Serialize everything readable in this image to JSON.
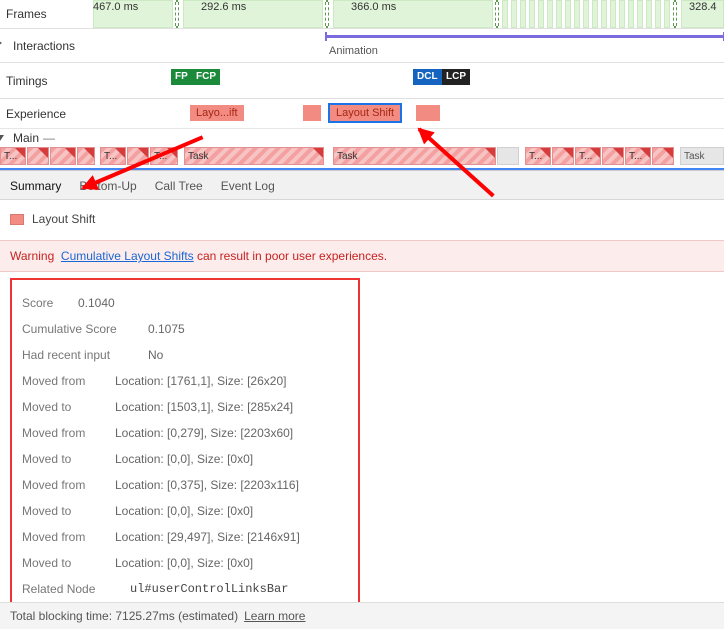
{
  "rows": {
    "frames": "Frames",
    "interactions": "Interactions",
    "timings": "Timings",
    "experience": "Experience",
    "main": "Main"
  },
  "frames": {
    "t0": "467.0 ms",
    "t1": "292.6 ms",
    "t2": "366.0 ms",
    "t3": "328.4"
  },
  "animation_label": "Animation",
  "timing_badges": {
    "fp": "FP",
    "fcp": "FCP",
    "dcl": "DCL",
    "lcp": "LCP"
  },
  "experience": {
    "chip1": "Layo...ift",
    "chip2": "Layout Shift"
  },
  "main_dash": "—",
  "tasks": {
    "short": "T...",
    "task": "Task"
  },
  "tabs": {
    "summary": "Summary",
    "bottomup": "Bottom-Up",
    "calltree": "Call Tree",
    "eventlog": "Event Log"
  },
  "legend": "Layout Shift",
  "warning": {
    "prefix": "Warning",
    "link": "Cumulative Layout Shifts",
    "suffix": " can result in poor user experiences."
  },
  "details": {
    "score_k": "Score",
    "score_v": "0.1040",
    "cumscore_k": "Cumulative Score",
    "cumscore_v": "0.1075",
    "hadinput_k": "Had recent input",
    "hadinput_v": "No",
    "mf": "Moved from",
    "mt": "Moved to",
    "loc1": "Location: [1761,1], Size: [26x20]",
    "loc2": "Location: [1503,1], Size: [285x24]",
    "loc3": "Location: [0,279], Size: [2203x60]",
    "loc4": "Location: [0,0], Size: [0x0]",
    "loc5": "Location: [0,375], Size: [2203x116]",
    "loc6": "Location: [0,0], Size: [0x0]",
    "loc7": "Location: [29,497], Size: [2146x91]",
    "loc8": "Location: [0,0], Size: [0x0]",
    "related_k": "Related Node",
    "related_v": "ul#userControlLinksBar"
  },
  "footer": {
    "text": "Total blocking time: 7125.27ms (estimated)",
    "link": "Learn more"
  }
}
